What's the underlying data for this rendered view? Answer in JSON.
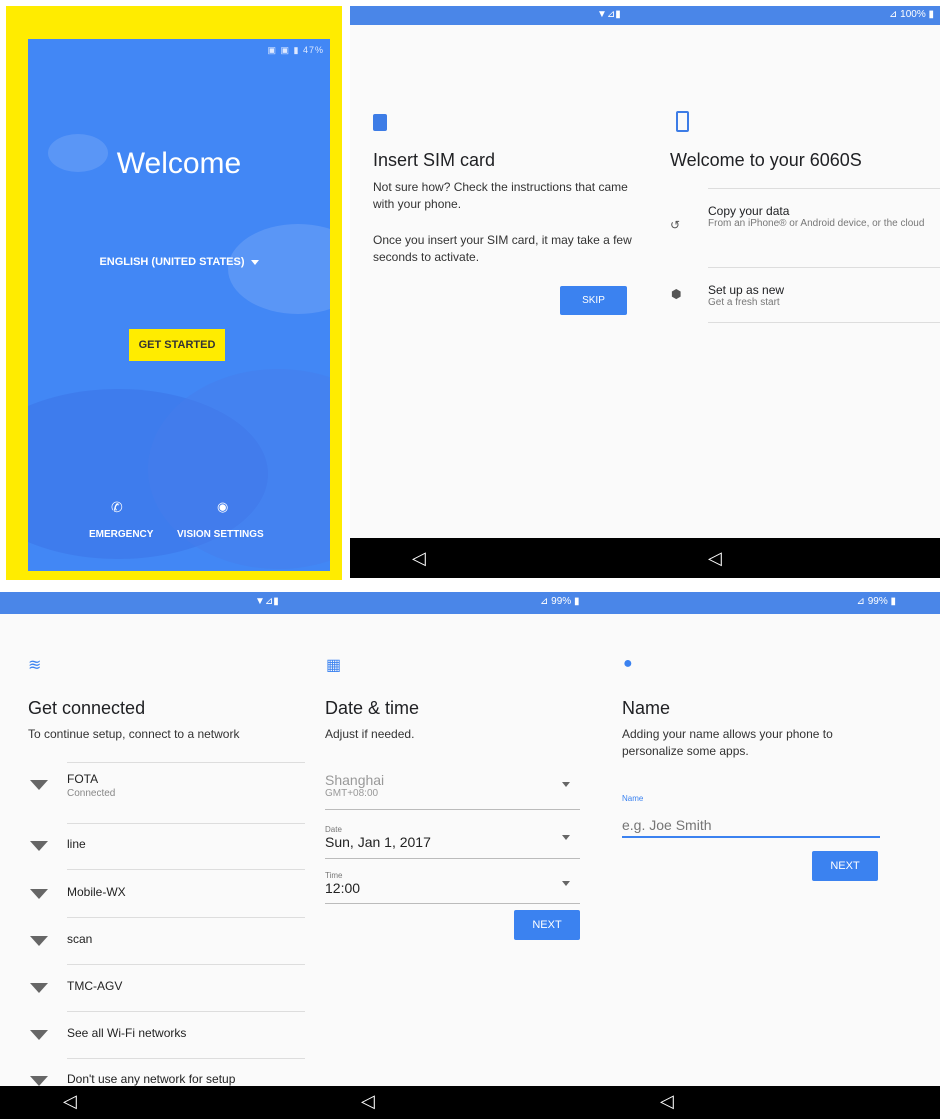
{
  "panel1": {
    "status": "47%",
    "welcome": "Welcome",
    "language": "ENGLISH (UNITED STATES)",
    "get_started": "GET STARTED",
    "emergency": "EMERGENCY",
    "vision": "VISION SETTINGS",
    "highlight_color": "#ffec00",
    "bg_color": "#4287f5"
  },
  "panel2": {
    "status_right": "100%",
    "sim_title": "Insert SIM card",
    "sim_text1": "Not sure how? Check the instructions that came with your phone.",
    "sim_text2": "Once you insert your SIM card, it may take a few seconds to activate.",
    "skip": "SKIP",
    "welcome_title": "Welcome to your 6060S",
    "copy_title": "Copy your data",
    "copy_sub": "From an iPhone® or Android device, or the cloud",
    "setup_title": "Set up as new",
    "setup_sub": "Get a fresh start"
  },
  "panel3": {
    "status_mid": "99%",
    "status_right": "99%",
    "connect_title": "Get connected",
    "connect_sub": "To continue setup, connect to a network",
    "networks": [
      {
        "name": "FOTA",
        "sub": "Connected"
      },
      {
        "name": "line",
        "sub": ""
      },
      {
        "name": "Mobile-WX",
        "sub": ""
      },
      {
        "name": "scan",
        "sub": ""
      },
      {
        "name": "TMC-AGV",
        "sub": ""
      },
      {
        "name": "See all Wi-Fi networks",
        "sub": ""
      },
      {
        "name": "Don't use any network for setup",
        "sub": ""
      }
    ],
    "date_title": "Date & time",
    "date_sub": "Adjust if needed.",
    "timezone": "Shanghai",
    "tz_offset": "GMT+08:00",
    "date_label": "Date",
    "date_value": "Sun, Jan 1, 2017",
    "time_label": "Time",
    "time_value": "12:00",
    "next1": "NEXT",
    "name_title": "Name",
    "name_sub": "Adding your name allows your phone to personalize some apps.",
    "name_label": "Name",
    "name_placeholder": "e.g. Joe Smith",
    "next2": "NEXT"
  }
}
